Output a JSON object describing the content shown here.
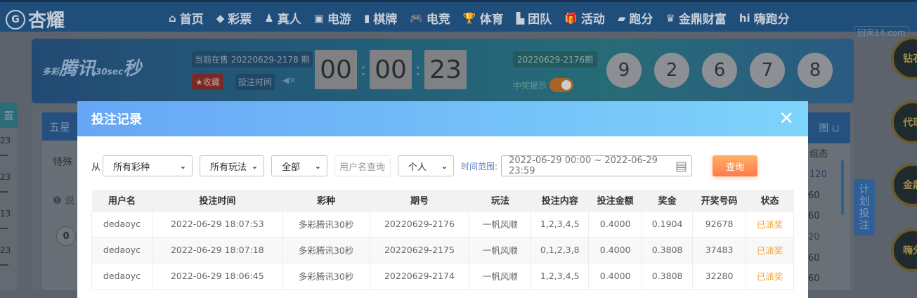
{
  "nav": {
    "logo": "杏耀",
    "logo_seal": "G",
    "items": [
      {
        "icon": "⌂",
        "label": "首页"
      },
      {
        "icon": "◆",
        "label": "彩票"
      },
      {
        "icon": "♟",
        "label": "真人"
      },
      {
        "icon": "▣",
        "label": "电游"
      },
      {
        "icon": "▮",
        "label": "棋牌"
      },
      {
        "icon": "🎮",
        "label": "电竞"
      },
      {
        "icon": "🏆",
        "label": "体育"
      },
      {
        "icon": "▙",
        "label": "团队"
      },
      {
        "icon": "🎁",
        "label": "活动"
      },
      {
        "icon": "▰",
        "label": "跑分"
      },
      {
        "icon": "♛",
        "label": "金鼎财富"
      },
      {
        "icon": "hi",
        "label": "嗨跑分"
      }
    ],
    "watermark": "回家14.com"
  },
  "lottery": {
    "logo_top": "多彩",
    "logo_main": "腾讯",
    "logo_sec": "30sec",
    "logo_end": "秒",
    "current": "当前在售 20220629-2178 期",
    "favorite": "★收藏",
    "bet_time": "投注时间",
    "mute": "◀×",
    "countdown": [
      "00",
      "00",
      "23"
    ],
    "prev_issue": "20220629-2176期",
    "win_notice": "中奖提示",
    "balls": [
      "9",
      "2",
      "6",
      "7",
      "8"
    ]
  },
  "background": {
    "side_tab": "置",
    "side_values": [
      "23",
      "23",
      "13",
      "23"
    ],
    "tab_five": "五星",
    "special": "特殊",
    "explain": "❶ 说",
    "zero": "0",
    "right_head": "图 ⊔",
    "right_label": "组态",
    "right_values": [
      "120",
      "60",
      "60",
      "20",
      "60",
      "60"
    ],
    "plan_bet": "计划投注",
    "badges": [
      "钻石",
      "代理",
      "金鼎",
      "嗨分"
    ]
  },
  "modal": {
    "title": "投注记录",
    "close": "✕",
    "filters": {
      "from_label": "从",
      "lottery": "所有彩种",
      "play": "所有玩法",
      "scope": "全部",
      "username_placeholder": "用户名查询",
      "mode": "个人",
      "range_label": "时间范围:",
      "date_range": "2022-06-29 00:00 ~ 2022-06-29 23:59",
      "query": "查询"
    },
    "columns": [
      "用户名",
      "投注时间",
      "彩种",
      "期号",
      "玩法",
      "投注内容",
      "投注金额",
      "奖金",
      "开奖号码",
      "状态"
    ],
    "rows": [
      [
        "dedaoyc",
        "2022-06-29 18:07:53",
        "多彩腾讯30秒",
        "20220629-2176",
        "一帆风顺",
        "1,2,3,4,5",
        "0.4000",
        "0.1904",
        "92678",
        "已派奖"
      ],
      [
        "dedaoyc",
        "2022-06-29 18:07:18",
        "多彩腾讯30秒",
        "20220629-2175",
        "一帆风顺",
        "0,1,2,3,8",
        "0.4000",
        "0.3808",
        "37483",
        "已派奖"
      ],
      [
        "dedaoyc",
        "2022-06-29 18:06:45",
        "多彩腾讯30秒",
        "20220629-2174",
        "一帆风顺",
        "1,2,3,4,5",
        "0.4000",
        "0.3808",
        "32280",
        "已派奖"
      ]
    ]
  }
}
